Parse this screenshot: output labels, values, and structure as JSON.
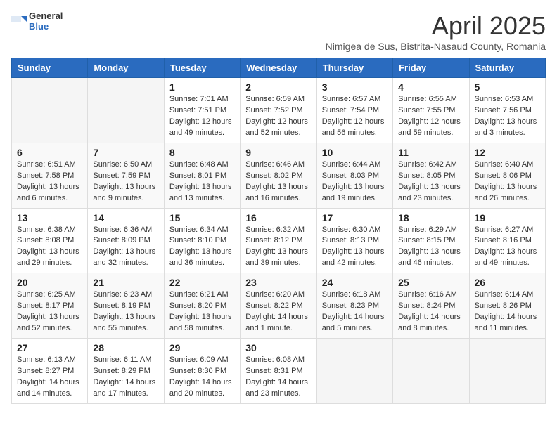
{
  "logo": {
    "line1": "General",
    "line2": "Blue"
  },
  "title": "April 2025",
  "subtitle": "Nimigea de Sus, Bistrita-Nasaud County, Romania",
  "weekdays": [
    "Sunday",
    "Monday",
    "Tuesday",
    "Wednesday",
    "Thursday",
    "Friday",
    "Saturday"
  ],
  "weeks": [
    [
      {
        "day": "",
        "info": ""
      },
      {
        "day": "",
        "info": ""
      },
      {
        "day": "1",
        "info": "Sunrise: 7:01 AM\nSunset: 7:51 PM\nDaylight: 12 hours and 49 minutes."
      },
      {
        "day": "2",
        "info": "Sunrise: 6:59 AM\nSunset: 7:52 PM\nDaylight: 12 hours and 52 minutes."
      },
      {
        "day": "3",
        "info": "Sunrise: 6:57 AM\nSunset: 7:54 PM\nDaylight: 12 hours and 56 minutes."
      },
      {
        "day": "4",
        "info": "Sunrise: 6:55 AM\nSunset: 7:55 PM\nDaylight: 12 hours and 59 minutes."
      },
      {
        "day": "5",
        "info": "Sunrise: 6:53 AM\nSunset: 7:56 PM\nDaylight: 13 hours and 3 minutes."
      }
    ],
    [
      {
        "day": "6",
        "info": "Sunrise: 6:51 AM\nSunset: 7:58 PM\nDaylight: 13 hours and 6 minutes."
      },
      {
        "day": "7",
        "info": "Sunrise: 6:50 AM\nSunset: 7:59 PM\nDaylight: 13 hours and 9 minutes."
      },
      {
        "day": "8",
        "info": "Sunrise: 6:48 AM\nSunset: 8:01 PM\nDaylight: 13 hours and 13 minutes."
      },
      {
        "day": "9",
        "info": "Sunrise: 6:46 AM\nSunset: 8:02 PM\nDaylight: 13 hours and 16 minutes."
      },
      {
        "day": "10",
        "info": "Sunrise: 6:44 AM\nSunset: 8:03 PM\nDaylight: 13 hours and 19 minutes."
      },
      {
        "day": "11",
        "info": "Sunrise: 6:42 AM\nSunset: 8:05 PM\nDaylight: 13 hours and 23 minutes."
      },
      {
        "day": "12",
        "info": "Sunrise: 6:40 AM\nSunset: 8:06 PM\nDaylight: 13 hours and 26 minutes."
      }
    ],
    [
      {
        "day": "13",
        "info": "Sunrise: 6:38 AM\nSunset: 8:08 PM\nDaylight: 13 hours and 29 minutes."
      },
      {
        "day": "14",
        "info": "Sunrise: 6:36 AM\nSunset: 8:09 PM\nDaylight: 13 hours and 32 minutes."
      },
      {
        "day": "15",
        "info": "Sunrise: 6:34 AM\nSunset: 8:10 PM\nDaylight: 13 hours and 36 minutes."
      },
      {
        "day": "16",
        "info": "Sunrise: 6:32 AM\nSunset: 8:12 PM\nDaylight: 13 hours and 39 minutes."
      },
      {
        "day": "17",
        "info": "Sunrise: 6:30 AM\nSunset: 8:13 PM\nDaylight: 13 hours and 42 minutes."
      },
      {
        "day": "18",
        "info": "Sunrise: 6:29 AM\nSunset: 8:15 PM\nDaylight: 13 hours and 46 minutes."
      },
      {
        "day": "19",
        "info": "Sunrise: 6:27 AM\nSunset: 8:16 PM\nDaylight: 13 hours and 49 minutes."
      }
    ],
    [
      {
        "day": "20",
        "info": "Sunrise: 6:25 AM\nSunset: 8:17 PM\nDaylight: 13 hours and 52 minutes."
      },
      {
        "day": "21",
        "info": "Sunrise: 6:23 AM\nSunset: 8:19 PM\nDaylight: 13 hours and 55 minutes."
      },
      {
        "day": "22",
        "info": "Sunrise: 6:21 AM\nSunset: 8:20 PM\nDaylight: 13 hours and 58 minutes."
      },
      {
        "day": "23",
        "info": "Sunrise: 6:20 AM\nSunset: 8:22 PM\nDaylight: 14 hours and 1 minute."
      },
      {
        "day": "24",
        "info": "Sunrise: 6:18 AM\nSunset: 8:23 PM\nDaylight: 14 hours and 5 minutes."
      },
      {
        "day": "25",
        "info": "Sunrise: 6:16 AM\nSunset: 8:24 PM\nDaylight: 14 hours and 8 minutes."
      },
      {
        "day": "26",
        "info": "Sunrise: 6:14 AM\nSunset: 8:26 PM\nDaylight: 14 hours and 11 minutes."
      }
    ],
    [
      {
        "day": "27",
        "info": "Sunrise: 6:13 AM\nSunset: 8:27 PM\nDaylight: 14 hours and 14 minutes."
      },
      {
        "day": "28",
        "info": "Sunrise: 6:11 AM\nSunset: 8:29 PM\nDaylight: 14 hours and 17 minutes."
      },
      {
        "day": "29",
        "info": "Sunrise: 6:09 AM\nSunset: 8:30 PM\nDaylight: 14 hours and 20 minutes."
      },
      {
        "day": "30",
        "info": "Sunrise: 6:08 AM\nSunset: 8:31 PM\nDaylight: 14 hours and 23 minutes."
      },
      {
        "day": "",
        "info": ""
      },
      {
        "day": "",
        "info": ""
      },
      {
        "day": "",
        "info": ""
      }
    ]
  ]
}
